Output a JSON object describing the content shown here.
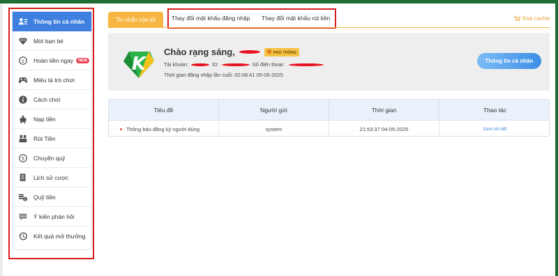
{
  "sidebar": {
    "items": [
      {
        "label": "Thông tin cá nhân",
        "icon": "profile-card-icon"
      },
      {
        "label": "Mời bạn bè",
        "icon": "invite-gem-icon"
      },
      {
        "label": "Hoàn tiền ngay",
        "icon": "refund-icon",
        "badge": "NEW"
      },
      {
        "label": "Miêu tả trò chơi",
        "icon": "gamepad-icon"
      },
      {
        "label": "Cách chơi",
        "icon": "info-icon"
      },
      {
        "label": "Nạp tiền",
        "icon": "piggy-bank-icon"
      },
      {
        "label": "Rút Tiền",
        "icon": "withdraw-icon"
      },
      {
        "label": "Chuyển quỹ",
        "icon": "dollar-circle-icon"
      },
      {
        "label": "Lịch sử cược",
        "icon": "history-doc-icon"
      },
      {
        "label": "Quỹ tiền",
        "icon": "coins-icon"
      },
      {
        "label": "Ý kiến phản hồi",
        "icon": "feedback-icon"
      },
      {
        "label": "Kết quả mở thưởng",
        "icon": "clock-history-icon"
      }
    ]
  },
  "tabs": {
    "active": "Tin nhắn của tôi",
    "change_login_password": "Thay đổi mật khẩu đăng nhập",
    "change_withdraw_password": "Thay đổi mật khẩu rút tiền",
    "clear_cache": "Xoá cache"
  },
  "profile": {
    "greeting": "Chào rạng sáng,",
    "rank": "PHỔ THÔNG",
    "account_label": "Tài khoản:",
    "id_label": "ID:",
    "phone_label": "Số điện thoại:",
    "last_login_label": "Thời gian đăng nhập lần cuối:",
    "last_login_value": "02:08:41 05-05-2025",
    "info_button": "Thông tin cá nhân",
    "logo_letter": "K"
  },
  "messages": {
    "headers": [
      "Tiêu đề",
      "Người gửi",
      "Thời gian",
      "Thao tác"
    ],
    "rows": [
      {
        "title": "Thông báo đăng ký người dùng",
        "sender": "system",
        "time": "21:53:37 04-05-2025",
        "action": "Xem chi tiết"
      }
    ]
  },
  "colors": {
    "accent_blue": "#3f7fe0",
    "tab_orange": "#f7b643",
    "highlight_red": "#d91c1c",
    "link_blue": "#3d7fd8"
  }
}
